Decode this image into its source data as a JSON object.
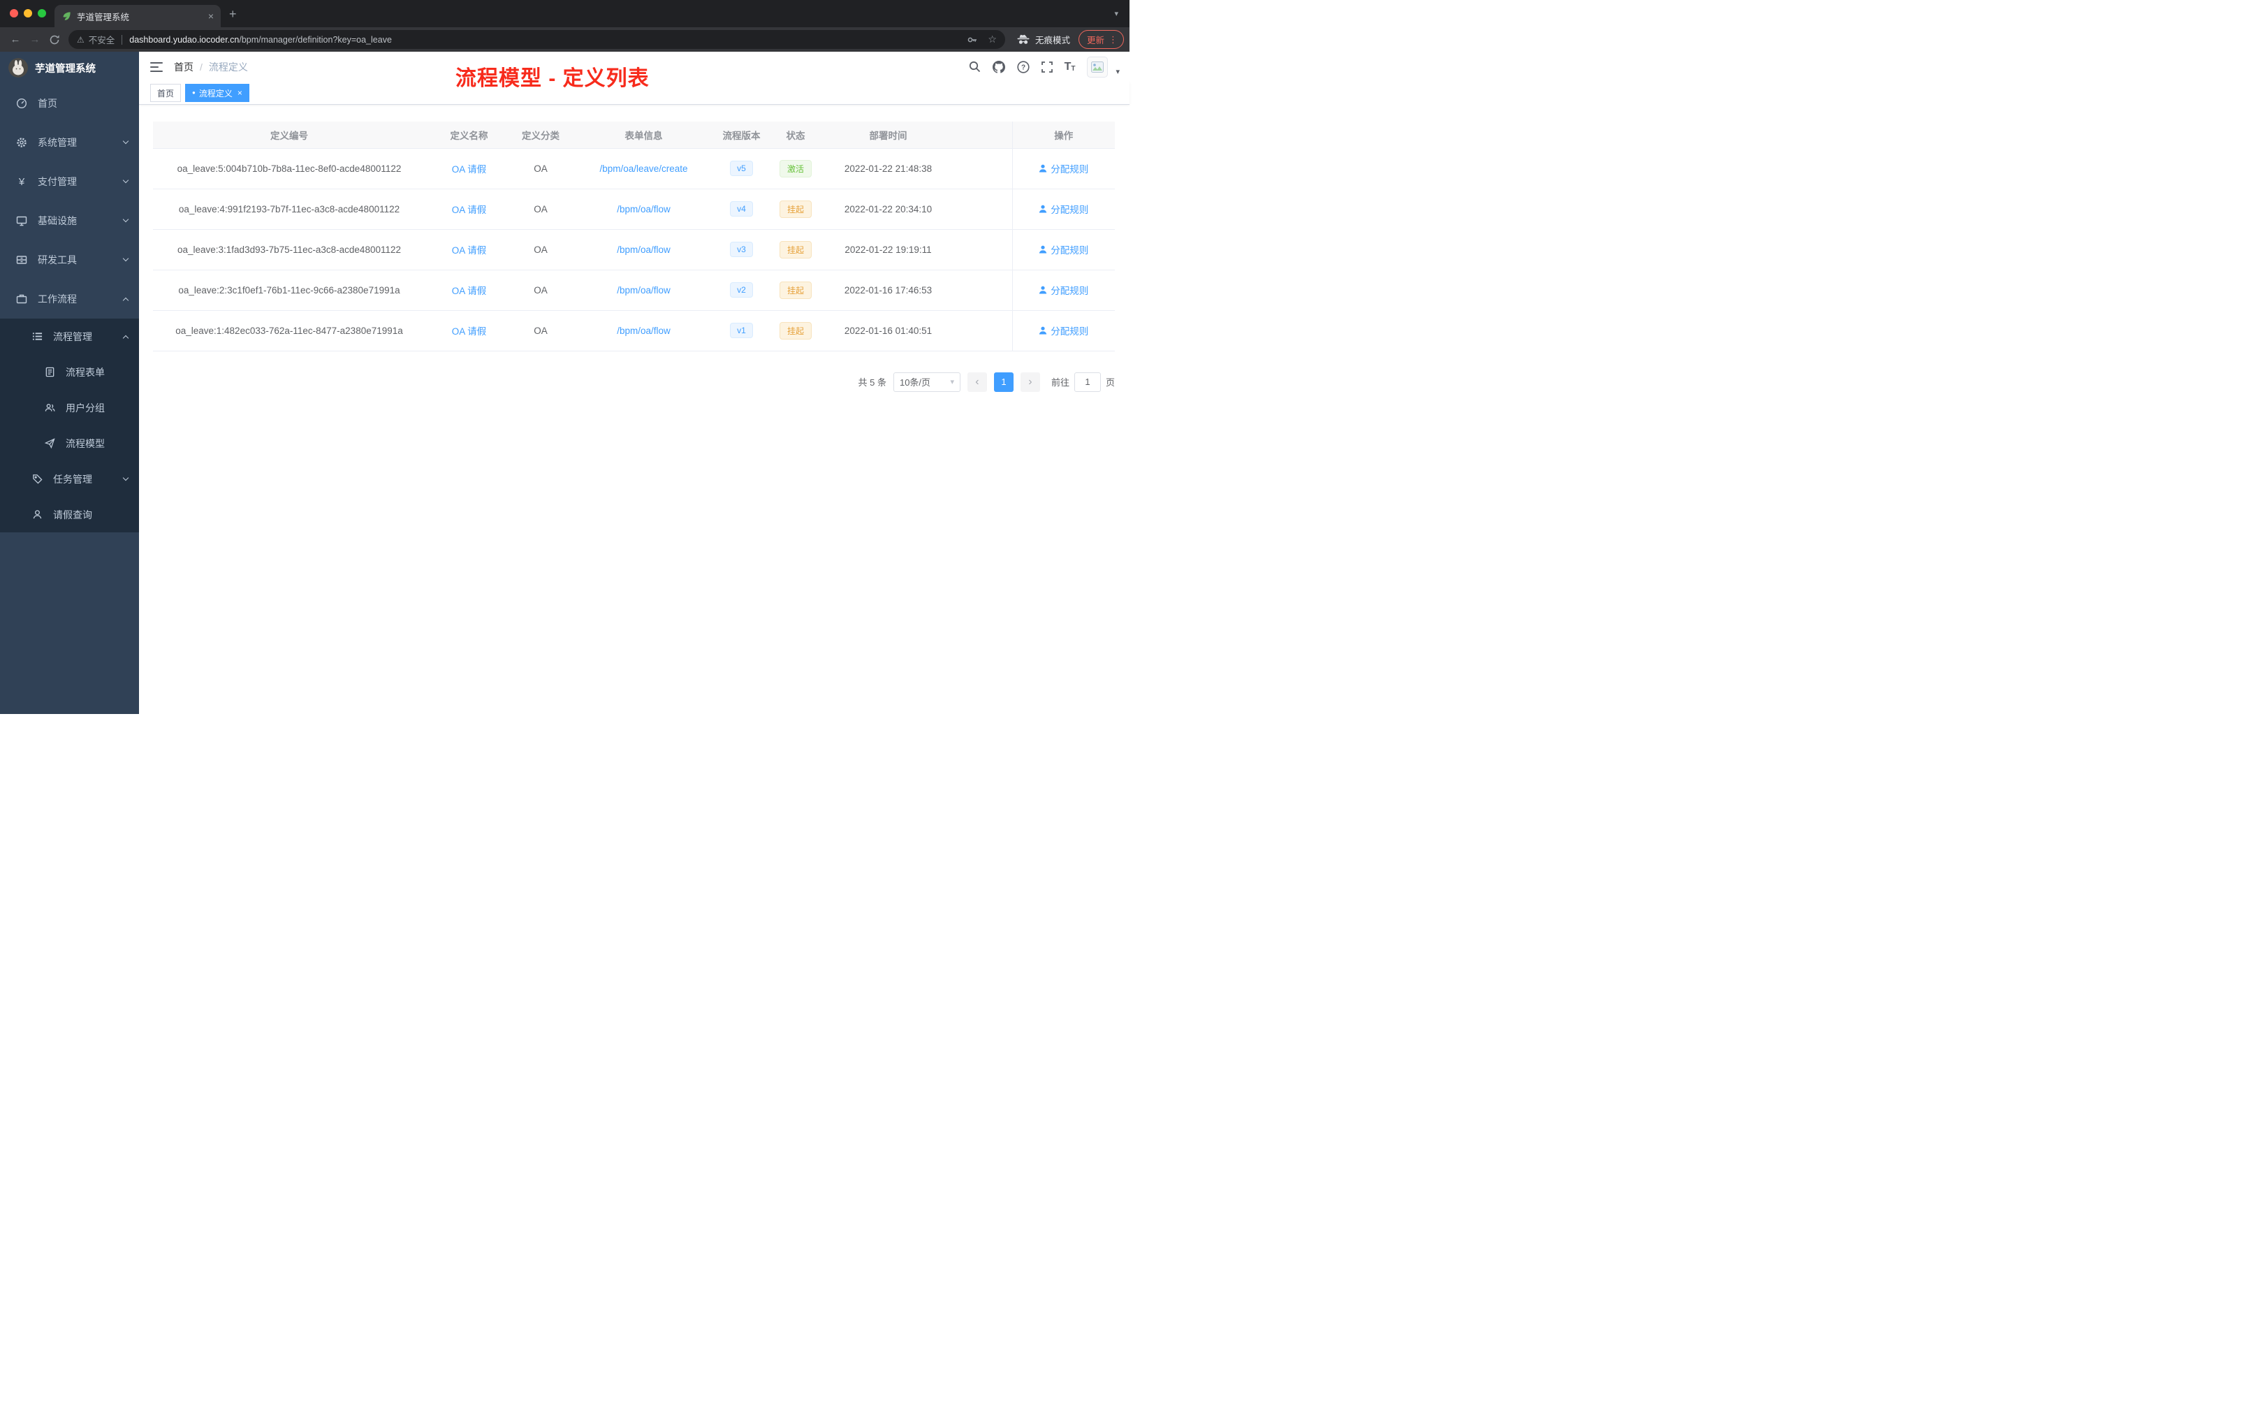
{
  "colors": {
    "accent": "#409eff",
    "success": "#67c23a",
    "warning": "#e6a23c",
    "annotation_red": "#f72b1c",
    "sidebar_bg": "#304156",
    "sidebar_sub_bg": "#1f2d3d"
  },
  "glyphs": {
    "close": "×",
    "plus": "+",
    "back_arrow": "←",
    "forward_arrow": "→",
    "star": "☆",
    "warning": "⚠",
    "kebab": "⋮",
    "prev": "‹",
    "next": "›",
    "caret_down": "▾",
    "dot": "●",
    "breadcrumb_separator": "/",
    "question": "?",
    "yen": "¥",
    "font_large": "T",
    "font_small": "T"
  },
  "browser": {
    "tab_title": "芋道管理系统",
    "security_label": "不安全",
    "url_host": "dashboard.yudao.iocoder.cn",
    "url_path": "/bpm/manager/definition?key=oa_leave",
    "incognito_label": "无痕模式",
    "update_label": "更新"
  },
  "sidebar": {
    "logo_title": "芋道管理系统",
    "items": [
      {
        "label": "首页",
        "icon": "dashboard-icon"
      },
      {
        "label": "系统管理",
        "icon": "gear-icon"
      },
      {
        "label": "支付管理",
        "icon": "yen-icon"
      },
      {
        "label": "基础设施",
        "icon": "monitor-icon"
      },
      {
        "label": "研发工具",
        "icon": "toolbox-icon"
      },
      {
        "label": "工作流程",
        "icon": "briefcase-icon"
      },
      {
        "label": "流程管理",
        "icon": "list-icon"
      },
      {
        "label": "流程表单",
        "icon": "form-icon"
      },
      {
        "label": "用户分组",
        "icon": "users-icon"
      },
      {
        "label": "流程模型",
        "icon": "send-icon"
      },
      {
        "label": "任务管理",
        "icon": "tag-icon"
      },
      {
        "label": "请假查询",
        "icon": "user-icon"
      }
    ]
  },
  "navbar": {
    "breadcrumb_home": "首页",
    "breadcrumb_current": "流程定义",
    "annotation": "流程模型 - 定义列表"
  },
  "tags": {
    "home": "首页",
    "active": "流程定义"
  },
  "table": {
    "columns": [
      "定义编号",
      "定义名称",
      "定义分类",
      "表单信息",
      "流程版本",
      "状态",
      "部署时间",
      "操作"
    ],
    "rows": [
      {
        "id": "oa_leave:5:004b710b-7b8a-11ec-8ef0-acde48001122",
        "name": "OA 请假",
        "category": "OA",
        "form": "/bpm/oa/leave/create",
        "version": "v5",
        "status": "激活",
        "deployed_at": "2022-01-22 21:48:38",
        "action": "分配规则"
      },
      {
        "id": "oa_leave:4:991f2193-7b7f-11ec-a3c8-acde48001122",
        "name": "OA 请假",
        "category": "OA",
        "form": "/bpm/oa/flow",
        "version": "v4",
        "status": "挂起",
        "deployed_at": "2022-01-22 20:34:10",
        "action": "分配规则"
      },
      {
        "id": "oa_leave:3:1fad3d93-7b75-11ec-a3c8-acde48001122",
        "name": "OA 请假",
        "category": "OA",
        "form": "/bpm/oa/flow",
        "version": "v3",
        "status": "挂起",
        "deployed_at": "2022-01-22 19:19:11",
        "action": "分配规则"
      },
      {
        "id": "oa_leave:2:3c1f0ef1-76b1-11ec-9c66-a2380e71991a",
        "name": "OA 请假",
        "category": "OA",
        "form": "/bpm/oa/flow",
        "version": "v2",
        "status": "挂起",
        "deployed_at": "2022-01-16 17:46:53",
        "action": "分配规则"
      },
      {
        "id": "oa_leave:1:482ec033-762a-11ec-8477-a2380e71991a",
        "name": "OA 请假",
        "category": "OA",
        "form": "/bpm/oa/flow",
        "version": "v1",
        "status": "挂起",
        "deployed_at": "2022-01-16 01:40:51",
        "action": "分配规则"
      }
    ]
  },
  "pagination": {
    "total": "共 5 条",
    "page_size": "10条/页",
    "page": "1",
    "goto_label": "前往",
    "goto_value": "1",
    "goto_unit": "页"
  }
}
